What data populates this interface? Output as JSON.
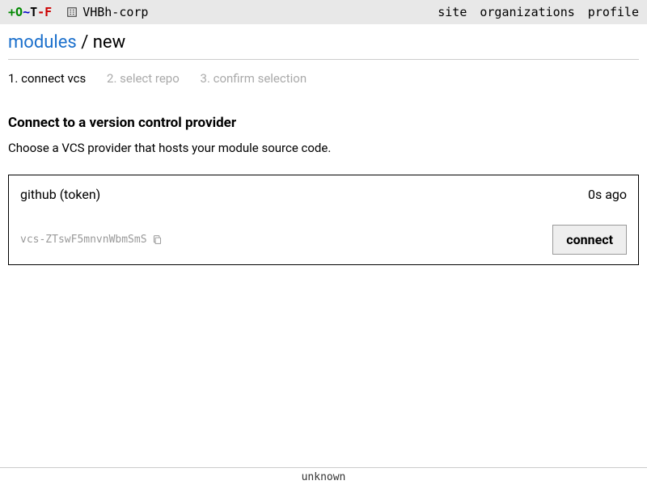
{
  "topbar": {
    "logo_chars": [
      "+",
      "O",
      "~",
      "T",
      "-",
      "F"
    ],
    "org_name": "VHBh-corp",
    "nav": {
      "site": "site",
      "organizations": "organizations",
      "profile": "profile"
    }
  },
  "breadcrumb": {
    "link": "modules",
    "sep": "/",
    "current": "new"
  },
  "steps": [
    {
      "label": "1. connect vcs",
      "active": true
    },
    {
      "label": "2. select repo",
      "active": false
    },
    {
      "label": "3. confirm selection",
      "active": false
    }
  ],
  "section": {
    "title": "Connect to a version control provider",
    "description": "Choose a VCS provider that hosts your module source code."
  },
  "provider": {
    "name": "github (token)",
    "age": "0s ago",
    "id": "vcs-ZTswF5mnvnWbmSmS",
    "connect_label": "connect"
  },
  "footer": {
    "text": "unknown"
  }
}
